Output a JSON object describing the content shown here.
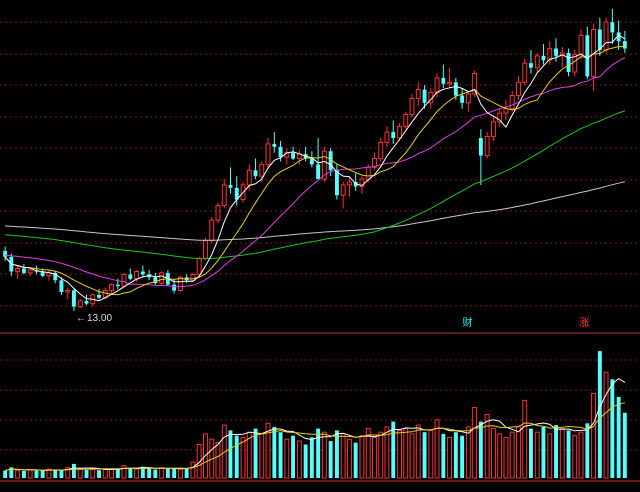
{
  "chart_data": [
    {
      "type": "candlestick",
      "title": "",
      "low_marker_label": "13.00",
      "event_badges": [
        {
          "text": "财",
          "index": 76,
          "color": "#00ffff"
        },
        {
          "text": "涨",
          "index": 94,
          "color": "#ff3b3b"
        }
      ],
      "candles": [
        [
          15.05,
          15.2,
          14.7,
          14.85
        ],
        [
          14.85,
          14.95,
          14.2,
          14.35
        ],
        [
          14.35,
          14.55,
          14.1,
          14.45
        ],
        [
          14.45,
          14.6,
          14.25,
          14.3
        ],
        [
          14.3,
          14.5,
          14.2,
          14.4
        ],
        [
          14.4,
          14.55,
          14.25,
          14.35
        ],
        [
          14.35,
          14.45,
          14.15,
          14.2
        ],
        [
          14.2,
          14.4,
          14.05,
          14.3
        ],
        [
          14.3,
          14.35,
          13.95,
          14.05
        ],
        [
          14.05,
          14.15,
          13.55,
          13.65
        ],
        [
          13.65,
          13.8,
          13.4,
          13.7
        ],
        [
          13.7,
          13.75,
          13.0,
          13.15
        ],
        [
          13.15,
          13.4,
          13.1,
          13.35
        ],
        [
          13.35,
          13.55,
          13.2,
          13.25
        ],
        [
          13.25,
          13.6,
          13.15,
          13.55
        ],
        [
          13.55,
          13.75,
          13.4,
          13.45
        ],
        [
          13.45,
          13.8,
          13.4,
          13.7
        ],
        [
          13.7,
          13.95,
          13.6,
          13.9
        ],
        [
          13.9,
          14.1,
          13.75,
          13.85
        ],
        [
          13.85,
          14.3,
          13.8,
          14.25
        ],
        [
          14.25,
          14.45,
          14.05,
          14.1
        ],
        [
          14.1,
          14.4,
          14.0,
          14.35
        ],
        [
          14.35,
          14.55,
          14.15,
          14.25
        ],
        [
          14.25,
          14.4,
          14.05,
          14.15
        ],
        [
          14.15,
          14.3,
          13.9,
          13.95
        ],
        [
          13.95,
          14.35,
          13.9,
          14.3
        ],
        [
          14.3,
          14.4,
          13.85,
          13.9
        ],
        [
          13.9,
          14.1,
          13.6,
          13.7
        ],
        [
          13.7,
          14.2,
          13.65,
          14.15
        ],
        [
          14.15,
          14.25,
          13.95,
          14.05
        ],
        [
          14.05,
          14.3,
          14.0,
          14.25
        ],
        [
          14.25,
          14.85,
          14.2,
          14.8
        ],
        [
          14.8,
          15.5,
          14.75,
          15.4
        ],
        [
          15.4,
          16.2,
          15.3,
          16.1
        ],
        [
          16.1,
          16.7,
          16.0,
          16.6
        ],
        [
          16.6,
          17.5,
          16.5,
          17.3
        ],
        [
          17.3,
          17.9,
          17.0,
          17.2
        ],
        [
          17.2,
          17.6,
          16.6,
          16.8
        ],
        [
          16.8,
          17.4,
          16.7,
          17.3
        ],
        [
          17.3,
          18.0,
          17.1,
          17.8
        ],
        [
          17.8,
          18.2,
          17.5,
          17.6
        ],
        [
          17.6,
          18.1,
          17.4,
          18.0
        ],
        [
          18.0,
          18.9,
          17.9,
          18.7
        ],
        [
          18.7,
          19.1,
          18.4,
          18.6
        ],
        [
          18.6,
          18.8,
          18.1,
          18.25
        ],
        [
          18.25,
          18.55,
          18.0,
          18.4
        ],
        [
          18.4,
          18.6,
          18.15,
          18.2
        ],
        [
          18.2,
          18.5,
          18.0,
          18.35
        ],
        [
          18.35,
          18.6,
          18.1,
          18.2
        ],
        [
          18.2,
          18.45,
          17.9,
          18.0
        ],
        [
          18.0,
          18.9,
          17.9,
          17.5
        ],
        [
          17.5,
          18.6,
          17.4,
          18.45
        ],
        [
          18.45,
          18.55,
          17.6,
          17.8
        ],
        [
          17.8,
          18.0,
          16.8,
          16.95
        ],
        [
          16.95,
          17.4,
          16.5,
          17.3
        ],
        [
          17.3,
          17.6,
          16.9,
          17.4
        ],
        [
          17.4,
          17.7,
          17.1,
          17.25
        ],
        [
          17.25,
          17.6,
          17.0,
          17.5
        ],
        [
          17.5,
          18.0,
          17.4,
          17.9
        ],
        [
          17.9,
          18.4,
          17.8,
          18.2
        ],
        [
          18.2,
          18.9,
          18.1,
          18.75
        ],
        [
          18.75,
          19.3,
          18.6,
          19.1
        ],
        [
          19.1,
          19.5,
          18.7,
          18.9
        ],
        [
          18.9,
          19.4,
          18.8,
          19.3
        ],
        [
          19.3,
          19.8,
          19.2,
          19.7
        ],
        [
          19.7,
          20.4,
          19.6,
          20.25
        ],
        [
          20.25,
          20.8,
          20.0,
          20.55
        ],
        [
          20.55,
          20.7,
          19.9,
          20.1
        ],
        [
          20.1,
          20.6,
          19.9,
          20.45
        ],
        [
          20.45,
          21.1,
          20.3,
          20.95
        ],
        [
          20.95,
          21.4,
          20.6,
          20.75
        ],
        [
          20.75,
          21.3,
          20.6,
          20.8
        ],
        [
          20.8,
          20.95,
          20.2,
          20.35
        ],
        [
          20.35,
          20.6,
          19.9,
          20.1
        ],
        [
          20.1,
          20.45,
          19.8,
          20.4
        ],
        [
          20.4,
          21.2,
          20.3,
          21.1
        ],
        [
          18.9,
          19.2,
          17.3,
          18.3
        ],
        [
          18.3,
          19.1,
          18.2,
          18.95
        ],
        [
          18.95,
          19.6,
          18.8,
          19.45
        ],
        [
          19.45,
          19.9,
          19.3,
          19.75
        ],
        [
          19.75,
          20.2,
          19.5,
          19.9
        ],
        [
          19.9,
          20.5,
          19.8,
          20.35
        ],
        [
          20.35,
          21.0,
          20.2,
          20.8
        ],
        [
          20.8,
          21.6,
          20.7,
          21.45
        ],
        [
          21.45,
          21.9,
          21.1,
          21.3
        ],
        [
          21.3,
          21.8,
          21.1,
          21.7
        ],
        [
          21.7,
          22.1,
          21.4,
          21.55
        ],
        [
          21.55,
          22.2,
          21.4,
          21.95
        ],
        [
          21.95,
          22.3,
          21.5,
          21.7
        ],
        [
          21.7,
          22.0,
          21.3,
          21.8
        ],
        [
          21.8,
          21.95,
          21.0,
          21.15
        ],
        [
          21.15,
          21.9,
          21.0,
          21.75
        ],
        [
          21.75,
          22.6,
          21.6,
          22.4
        ],
        [
          22.4,
          22.7,
          20.9,
          21.0
        ],
        [
          21.0,
          22.8,
          20.5,
          22.6
        ],
        [
          22.6,
          23.0,
          21.7,
          21.9
        ],
        [
          21.9,
          23.0,
          21.8,
          22.85
        ],
        [
          22.85,
          23.3,
          22.1,
          22.5
        ],
        [
          22.5,
          22.9,
          21.9,
          22.2
        ],
        [
          22.2,
          22.55,
          21.8,
          21.95
        ]
      ],
      "volumes": [
        2.1,
        3.0,
        2.2,
        2.0,
        2.3,
        2.1,
        2.0,
        2.5,
        2.4,
        2.2,
        2.9,
        4.0,
        2.6,
        2.3,
        2.4,
        2.2,
        2.6,
        2.5,
        2.7,
        3.5,
        2.8,
        2.6,
        3.2,
        2.7,
        2.4,
        2.9,
        2.6,
        2.8,
        2.5,
        2.7,
        4.5,
        9.5,
        12.5,
        11.0,
        10.0,
        15.0,
        13.5,
        12.0,
        11.5,
        13.0,
        14.0,
        12.5,
        15.5,
        14.5,
        13.0,
        11.0,
        12.0,
        10.5,
        9.5,
        11.5,
        14.0,
        13.0,
        10.5,
        13.5,
        12.5,
        11.0,
        10.0,
        12.0,
        14.0,
        11.5,
        13.0,
        14.5,
        16.0,
        13.5,
        14.0,
        12.5,
        15.0,
        13.0,
        13.5,
        16.5,
        12.5,
        11.5,
        13.0,
        12.0,
        14.5,
        20.0,
        16.0,
        18.0,
        14.0,
        12.5,
        11.5,
        13.0,
        14.5,
        22.0,
        14.0,
        13.0,
        14.5,
        12.5,
        15.0,
        14.0,
        13.5,
        12.0,
        13.0,
        15.5,
        24.0,
        36.0,
        30.0,
        28.0,
        23.0,
        18.5
      ]
    }
  ]
}
